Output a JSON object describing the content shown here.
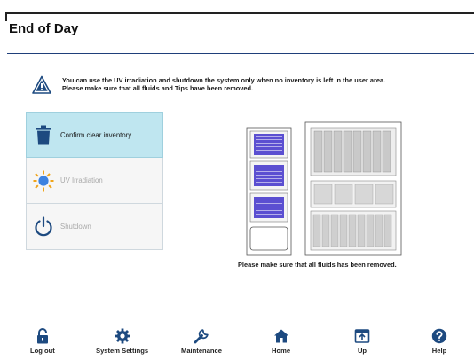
{
  "header": {
    "title": "End of Day"
  },
  "notice": {
    "line1": "You can use the UV irradiation and shutdown the system only when no inventory is left in the user area.",
    "line2": "Please make sure that all fluids and Tips have been removed."
  },
  "actions": [
    {
      "label": "Confirm clear inventory",
      "icon": "trash-icon",
      "state": "active"
    },
    {
      "label": "UV Irradiation",
      "icon": "sun-icon",
      "state": "disabled"
    },
    {
      "label": "Shutdown",
      "icon": "power-icon",
      "state": "disabled"
    }
  ],
  "diagram": {
    "caption": "Please make sure that all fluids has been removed."
  },
  "nav": [
    {
      "label": "Log out",
      "icon": "lock-icon"
    },
    {
      "label": "System Settings",
      "icon": "gear-icon"
    },
    {
      "label": "Maintenance",
      "icon": "wrench-icon"
    },
    {
      "label": "Home",
      "icon": "home-icon"
    },
    {
      "label": "Up",
      "icon": "up-icon"
    },
    {
      "label": "Help",
      "icon": "help-icon"
    }
  ],
  "colors": {
    "accent": "#1f3f7a",
    "active_bg": "#bfe6f0",
    "icon_blue": "#1d4a80",
    "plate_purple": "#5b4fd1"
  }
}
